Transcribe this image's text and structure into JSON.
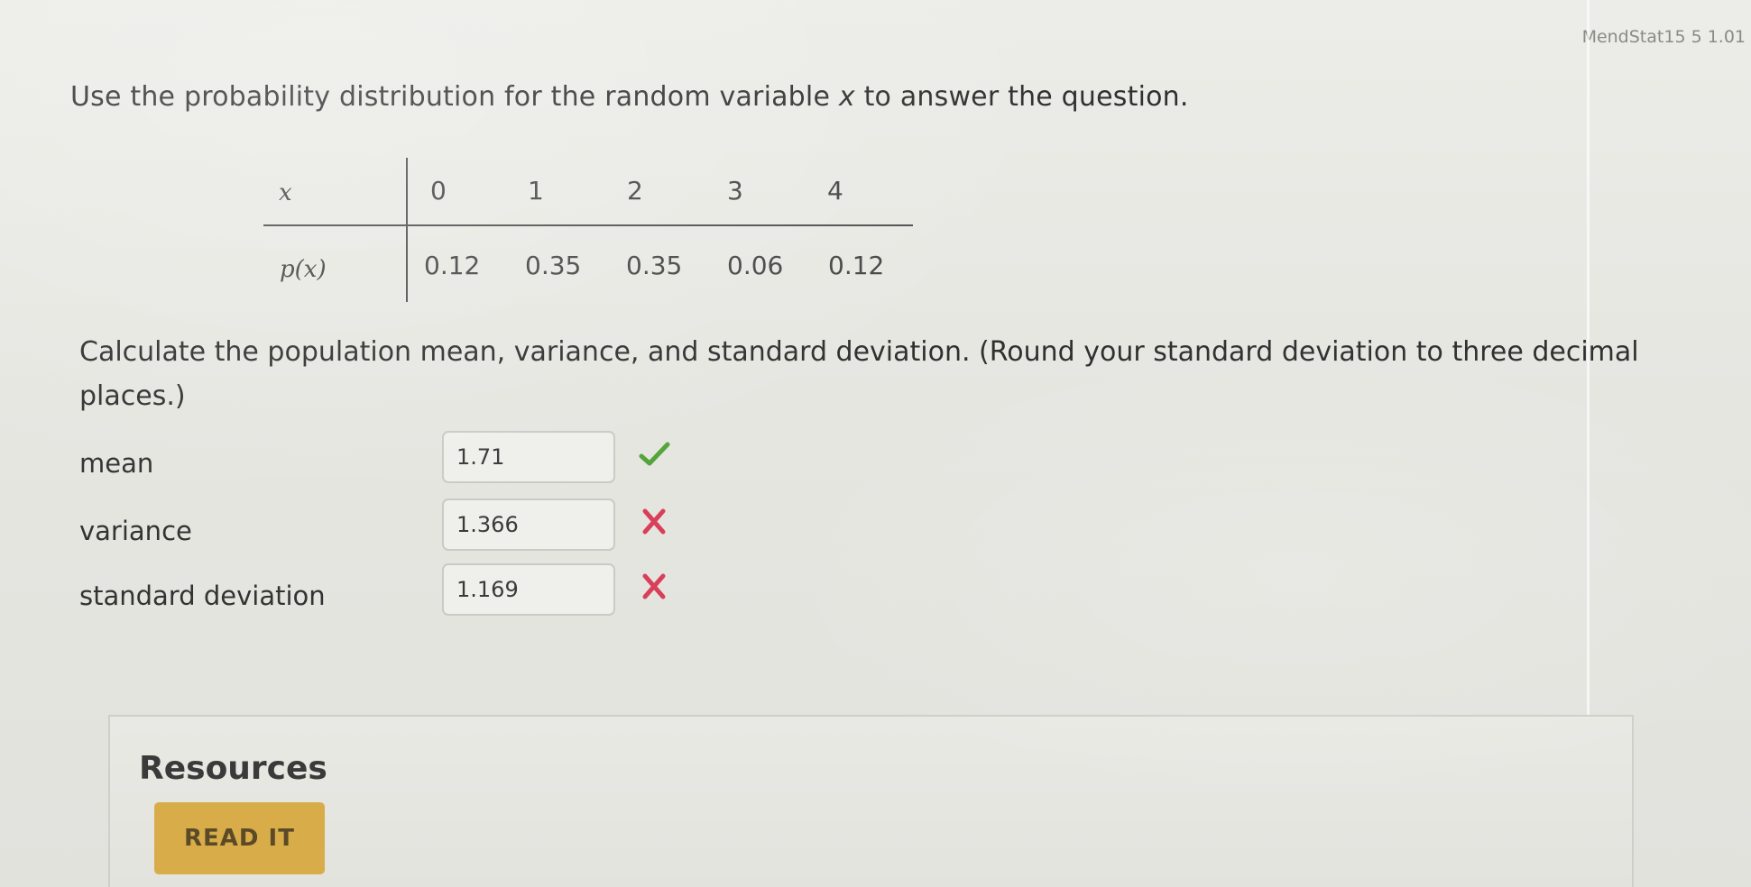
{
  "header": {
    "problem_id": "MendStat15 5 1.01"
  },
  "question": {
    "prompt_before": "Use the probability distribution for the random variable ",
    "variable": "x",
    "prompt_after": " to answer the question.",
    "instruction": "Calculate the population mean, variance, and standard deviation. (Round your standard deviation to three decimal places.)"
  },
  "table": {
    "x_label": "x",
    "p_label": "p(x)",
    "x_values": [
      "0",
      "1",
      "2",
      "3",
      "4"
    ],
    "p_values": [
      "0.12",
      "0.35",
      "0.35",
      "0.06",
      "0.12"
    ]
  },
  "answers": [
    {
      "label": "mean",
      "value": "1.71",
      "status": "correct"
    },
    {
      "label": "variance",
      "value": "1.366",
      "status": "incorrect"
    },
    {
      "label": "standard deviation",
      "value": "1.169",
      "status": "incorrect"
    }
  ],
  "resources": {
    "title": "Resources",
    "read_button": "READ IT"
  },
  "icons": {
    "correct": "check-icon",
    "incorrect": "cross-icon"
  },
  "colors": {
    "correct": "#54a43b",
    "incorrect": "#d93f59",
    "read_button": "#d8ac49"
  }
}
